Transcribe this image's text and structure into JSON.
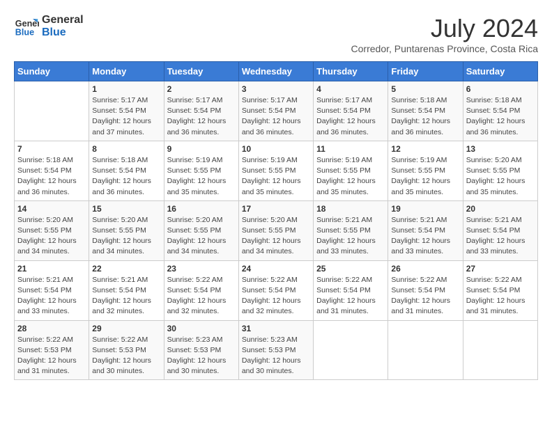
{
  "logo": {
    "line1": "General",
    "line2": "Blue"
  },
  "title": "July 2024",
  "subtitle": "Corredor, Puntarenas Province, Costa Rica",
  "days_header": [
    "Sunday",
    "Monday",
    "Tuesday",
    "Wednesday",
    "Thursday",
    "Friday",
    "Saturday"
  ],
  "weeks": [
    [
      {
        "day": "",
        "info": ""
      },
      {
        "day": "1",
        "info": "Sunrise: 5:17 AM\nSunset: 5:54 PM\nDaylight: 12 hours\nand 37 minutes."
      },
      {
        "day": "2",
        "info": "Sunrise: 5:17 AM\nSunset: 5:54 PM\nDaylight: 12 hours\nand 36 minutes."
      },
      {
        "day": "3",
        "info": "Sunrise: 5:17 AM\nSunset: 5:54 PM\nDaylight: 12 hours\nand 36 minutes."
      },
      {
        "day": "4",
        "info": "Sunrise: 5:17 AM\nSunset: 5:54 PM\nDaylight: 12 hours\nand 36 minutes."
      },
      {
        "day": "5",
        "info": "Sunrise: 5:18 AM\nSunset: 5:54 PM\nDaylight: 12 hours\nand 36 minutes."
      },
      {
        "day": "6",
        "info": "Sunrise: 5:18 AM\nSunset: 5:54 PM\nDaylight: 12 hours\nand 36 minutes."
      }
    ],
    [
      {
        "day": "7",
        "info": "Sunrise: 5:18 AM\nSunset: 5:54 PM\nDaylight: 12 hours\nand 36 minutes."
      },
      {
        "day": "8",
        "info": "Sunrise: 5:18 AM\nSunset: 5:54 PM\nDaylight: 12 hours\nand 36 minutes."
      },
      {
        "day": "9",
        "info": "Sunrise: 5:19 AM\nSunset: 5:55 PM\nDaylight: 12 hours\nand 35 minutes."
      },
      {
        "day": "10",
        "info": "Sunrise: 5:19 AM\nSunset: 5:55 PM\nDaylight: 12 hours\nand 35 minutes."
      },
      {
        "day": "11",
        "info": "Sunrise: 5:19 AM\nSunset: 5:55 PM\nDaylight: 12 hours\nand 35 minutes."
      },
      {
        "day": "12",
        "info": "Sunrise: 5:19 AM\nSunset: 5:55 PM\nDaylight: 12 hours\nand 35 minutes."
      },
      {
        "day": "13",
        "info": "Sunrise: 5:20 AM\nSunset: 5:55 PM\nDaylight: 12 hours\nand 35 minutes."
      }
    ],
    [
      {
        "day": "14",
        "info": "Sunrise: 5:20 AM\nSunset: 5:55 PM\nDaylight: 12 hours\nand 34 minutes."
      },
      {
        "day": "15",
        "info": "Sunrise: 5:20 AM\nSunset: 5:55 PM\nDaylight: 12 hours\nand 34 minutes."
      },
      {
        "day": "16",
        "info": "Sunrise: 5:20 AM\nSunset: 5:55 PM\nDaylight: 12 hours\nand 34 minutes."
      },
      {
        "day": "17",
        "info": "Sunrise: 5:20 AM\nSunset: 5:55 PM\nDaylight: 12 hours\nand 34 minutes."
      },
      {
        "day": "18",
        "info": "Sunrise: 5:21 AM\nSunset: 5:55 PM\nDaylight: 12 hours\nand 33 minutes."
      },
      {
        "day": "19",
        "info": "Sunrise: 5:21 AM\nSunset: 5:54 PM\nDaylight: 12 hours\nand 33 minutes."
      },
      {
        "day": "20",
        "info": "Sunrise: 5:21 AM\nSunset: 5:54 PM\nDaylight: 12 hours\nand 33 minutes."
      }
    ],
    [
      {
        "day": "21",
        "info": "Sunrise: 5:21 AM\nSunset: 5:54 PM\nDaylight: 12 hours\nand 33 minutes."
      },
      {
        "day": "22",
        "info": "Sunrise: 5:21 AM\nSunset: 5:54 PM\nDaylight: 12 hours\nand 32 minutes."
      },
      {
        "day": "23",
        "info": "Sunrise: 5:22 AM\nSunset: 5:54 PM\nDaylight: 12 hours\nand 32 minutes."
      },
      {
        "day": "24",
        "info": "Sunrise: 5:22 AM\nSunset: 5:54 PM\nDaylight: 12 hours\nand 32 minutes."
      },
      {
        "day": "25",
        "info": "Sunrise: 5:22 AM\nSunset: 5:54 PM\nDaylight: 12 hours\nand 31 minutes."
      },
      {
        "day": "26",
        "info": "Sunrise: 5:22 AM\nSunset: 5:54 PM\nDaylight: 12 hours\nand 31 minutes."
      },
      {
        "day": "27",
        "info": "Sunrise: 5:22 AM\nSunset: 5:54 PM\nDaylight: 12 hours\nand 31 minutes."
      }
    ],
    [
      {
        "day": "28",
        "info": "Sunrise: 5:22 AM\nSunset: 5:53 PM\nDaylight: 12 hours\nand 31 minutes."
      },
      {
        "day": "29",
        "info": "Sunrise: 5:22 AM\nSunset: 5:53 PM\nDaylight: 12 hours\nand 30 minutes."
      },
      {
        "day": "30",
        "info": "Sunrise: 5:23 AM\nSunset: 5:53 PM\nDaylight: 12 hours\nand 30 minutes."
      },
      {
        "day": "31",
        "info": "Sunrise: 5:23 AM\nSunset: 5:53 PM\nDaylight: 12 hours\nand 30 minutes."
      },
      {
        "day": "",
        "info": ""
      },
      {
        "day": "",
        "info": ""
      },
      {
        "day": "",
        "info": ""
      }
    ]
  ]
}
